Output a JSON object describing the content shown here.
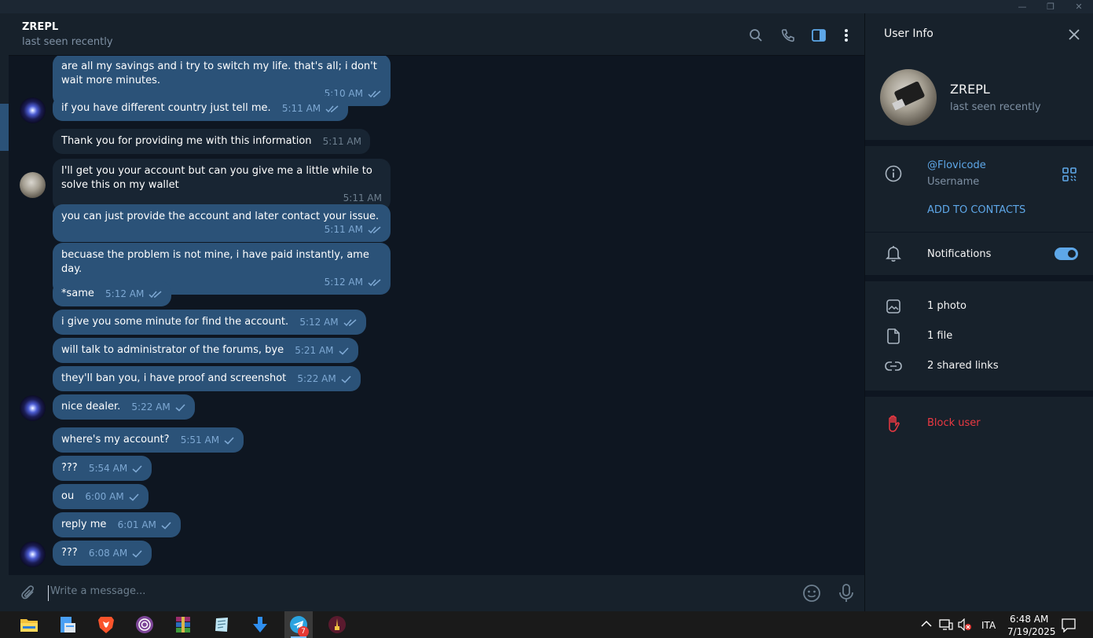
{
  "window": {
    "controls": [
      "—",
      "❐",
      "✕"
    ]
  },
  "header": {
    "name": "ZREPL",
    "status": "last seen recently",
    "icons": [
      "search-icon",
      "phone-icon",
      "sidebar-toggle-icon",
      "more-vertical-icon"
    ]
  },
  "messages": [
    {
      "text": "are all my savings and i try to switch my life. that's all; i don't wait more minutes.",
      "time": "5:10 AM",
      "dir": "out",
      "status": "read"
    },
    {
      "text": "if you have different country just tell me.",
      "time": "5:11 AM",
      "dir": "out",
      "status": "read"
    },
    {
      "text": "Thank you for providing me with this information",
      "time": "5:11 AM",
      "dir": "in"
    },
    {
      "text": "I'll get you your account but can you give me a little while to solve this on my wallet",
      "time": "5:11 AM",
      "dir": "in"
    },
    {
      "text": "you can just provide the account and later contact your issue.",
      "time": "5:11 AM",
      "dir": "out",
      "status": "read"
    },
    {
      "text": "becuase the problem is not mine, i have paid instantly, ame day.",
      "time": "5:12 AM",
      "dir": "out",
      "status": "read"
    },
    {
      "text": "*same",
      "time": "5:12 AM",
      "dir": "out",
      "status": "read"
    },
    {
      "text": "i give you some minute for find the account.",
      "time": "5:12 AM",
      "dir": "out",
      "status": "read"
    },
    {
      "text": "will talk to administrator of the forums, bye",
      "time": "5:21 AM",
      "dir": "out",
      "status": "sent"
    },
    {
      "text": "they'll ban you, i have proof and screenshot",
      "time": "5:22 AM",
      "dir": "out",
      "status": "sent"
    },
    {
      "text": "nice dealer.",
      "time": "5:22 AM",
      "dir": "out",
      "status": "sent"
    },
    {
      "text": "where's my account?",
      "time": "5:51 AM",
      "dir": "out",
      "status": "sent"
    },
    {
      "text": "???",
      "time": "5:54 AM",
      "dir": "out",
      "status": "sent"
    },
    {
      "text": "ou",
      "time": "6:00 AM",
      "dir": "out",
      "status": "sent"
    },
    {
      "text": "reply me",
      "time": "6:01 AM",
      "dir": "out",
      "status": "sent"
    },
    {
      "text": "???",
      "time": "6:08 AM",
      "dir": "out",
      "status": "sent"
    }
  ],
  "composer": {
    "placeholder": "Write a message..."
  },
  "user_info": {
    "title": "User Info",
    "name": "ZREPL",
    "status": "last seen recently",
    "username": "@Flovicode",
    "username_label": "Username",
    "add_contacts": "ADD TO CONTACTS",
    "notifications_label": "Notifications",
    "notifications_on": true,
    "media": [
      {
        "label": "1 photo",
        "icon": "photo-icon"
      },
      {
        "label": "1 file",
        "icon": "file-icon"
      },
      {
        "label": "2 shared links",
        "icon": "link-icon"
      }
    ],
    "block_label": "Block user"
  },
  "taskbar": {
    "telegram_badge": "7",
    "lang": "ITA",
    "time": "6:48 AM",
    "date": "7/19/2025"
  },
  "colors": {
    "accent": "#5ea7e8",
    "danger": "#ec3942",
    "bubble_out": "#2b5278",
    "bubble_in": "#182533",
    "bg": "#0e1621"
  }
}
